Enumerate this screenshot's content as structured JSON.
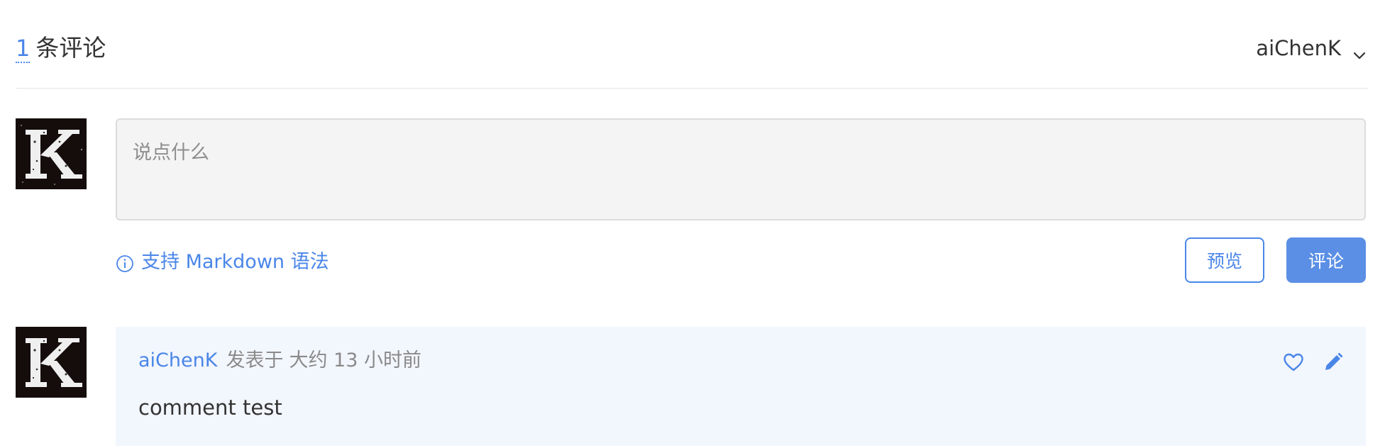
{
  "header": {
    "comment_count": "1",
    "count_label": "条评论",
    "current_user": "aiChenK",
    "dropdown_icon": "chevron-down-icon"
  },
  "editor": {
    "placeholder": "说点什么",
    "value": ""
  },
  "markdown_hint": {
    "icon": "info-circle-icon",
    "label": "支持 Markdown 语法"
  },
  "buttons": {
    "preview_label": "预览",
    "submit_label": "评论"
  },
  "comments": [
    {
      "author": "aiChenK",
      "posted_label": "发表于",
      "time": "大约 13 小时前",
      "body": "comment test",
      "actions": [
        "heart-icon",
        "pencil-icon"
      ]
    }
  ],
  "colors": {
    "accent": "#4a86e8",
    "submit_bg": "#5a8fe5",
    "comment_bg": "#f2f6fd",
    "editor_bg": "#f4f4f4"
  }
}
